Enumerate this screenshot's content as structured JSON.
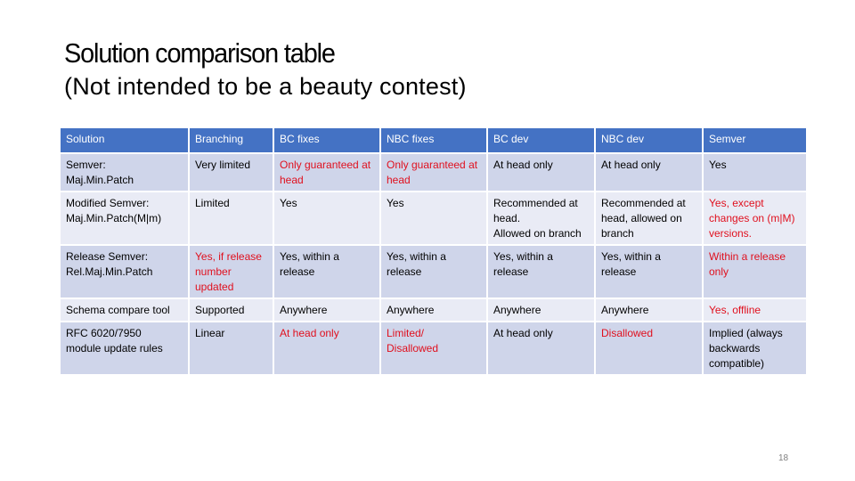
{
  "slide": {
    "title": "Solution comparison table",
    "subtitle": "(Not intended to be a beauty contest)",
    "page_number": "18"
  },
  "colors": {
    "header_bg": "#4472c4",
    "row_dark": "#cfd5ea",
    "row_light": "#e9ebf5",
    "highlight_text": "#e0101e"
  },
  "table": {
    "headers": [
      "Solution",
      "Branching",
      "BC fixes",
      "NBC fixes",
      "BC dev",
      "NBC dev",
      "Semver"
    ],
    "rows": [
      {
        "cells": [
          {
            "text": "Semver:\nMaj.Min.Patch",
            "highlight": false
          },
          {
            "text": "Very limited",
            "highlight": false
          },
          {
            "text": "Only guaranteed at head",
            "highlight": true
          },
          {
            "text": "Only guaranteed at head",
            "highlight": true
          },
          {
            "text": "At head only",
            "highlight": false
          },
          {
            "text": "At head only",
            "highlight": false
          },
          {
            "text": "Yes",
            "highlight": false
          }
        ]
      },
      {
        "cells": [
          {
            "text": "Modified Semver:\nMaj.Min.Patch(M|m)",
            "highlight": false
          },
          {
            "text": "Limited",
            "highlight": false
          },
          {
            "text": "Yes",
            "highlight": false
          },
          {
            "text": "Yes",
            "highlight": false
          },
          {
            "text": "Recommended at head.\nAllowed on branch",
            "highlight": false
          },
          {
            "text": "Recommended at head, allowed on branch",
            "highlight": false
          },
          {
            "text": "Yes, except changes on (m|M) versions.",
            "highlight": true
          }
        ]
      },
      {
        "cells": [
          {
            "text": "Release Semver:\nRel.Maj.Min.Patch",
            "highlight": false
          },
          {
            "text": "Yes, if release number updated",
            "highlight": true
          },
          {
            "text": "Yes, within a release",
            "highlight": false
          },
          {
            "text": "Yes, within a release",
            "highlight": false
          },
          {
            "text": "Yes, within a release",
            "highlight": false
          },
          {
            "text": "Yes, within a release",
            "highlight": false
          },
          {
            "text": "Within a release only",
            "highlight": true
          }
        ]
      },
      {
        "cells": [
          {
            "text": "Schema compare tool",
            "highlight": false
          },
          {
            "text": "Supported",
            "highlight": false
          },
          {
            "text": "Anywhere",
            "highlight": false
          },
          {
            "text": "Anywhere",
            "highlight": false
          },
          {
            "text": "Anywhere",
            "highlight": false
          },
          {
            "text": "Anywhere",
            "highlight": false
          },
          {
            "text": "Yes, offline",
            "highlight": true
          }
        ]
      },
      {
        "cells": [
          {
            "text": "RFC 6020/7950\nmodule update rules",
            "highlight": false
          },
          {
            "text": "Linear",
            "highlight": false
          },
          {
            "text": "At head only",
            "highlight": true
          },
          {
            "text": "Limited/\nDisallowed",
            "highlight": true
          },
          {
            "text": "At head only",
            "highlight": false
          },
          {
            "text": "Disallowed",
            "highlight": true
          },
          {
            "text": "Implied (always backwards compatible)",
            "highlight": false
          }
        ]
      }
    ]
  }
}
